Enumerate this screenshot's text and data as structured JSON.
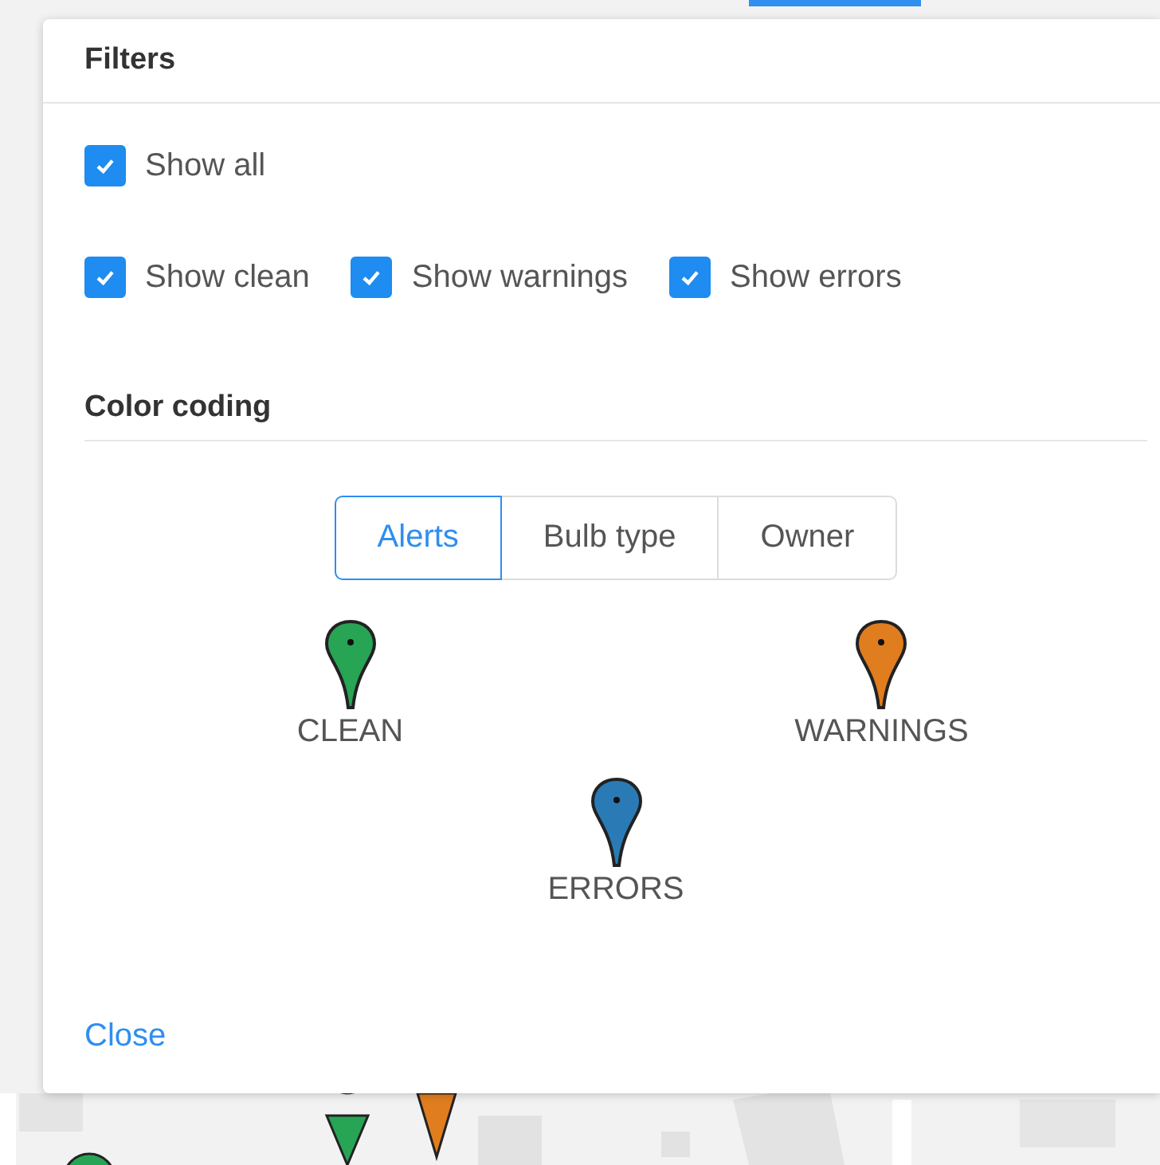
{
  "panel": {
    "title": "Filters",
    "filters": [
      {
        "label": "Show all",
        "checked": true
      },
      {
        "label": "Show clean",
        "checked": true
      },
      {
        "label": "Show warnings",
        "checked": true
      },
      {
        "label": "Show errors",
        "checked": true
      }
    ],
    "color_coding": {
      "heading": "Color coding",
      "tabs": [
        {
          "label": "Alerts",
          "selected": true
        },
        {
          "label": "Bulb type",
          "selected": false
        },
        {
          "label": "Owner",
          "selected": false
        }
      ],
      "legend": [
        {
          "label": "CLEAN",
          "color": "#27a555"
        },
        {
          "label": "WARNINGS",
          "color": "#e07d1f"
        },
        {
          "label": "ERRORS",
          "color": "#2a7bb5"
        }
      ]
    },
    "close": "Close"
  }
}
